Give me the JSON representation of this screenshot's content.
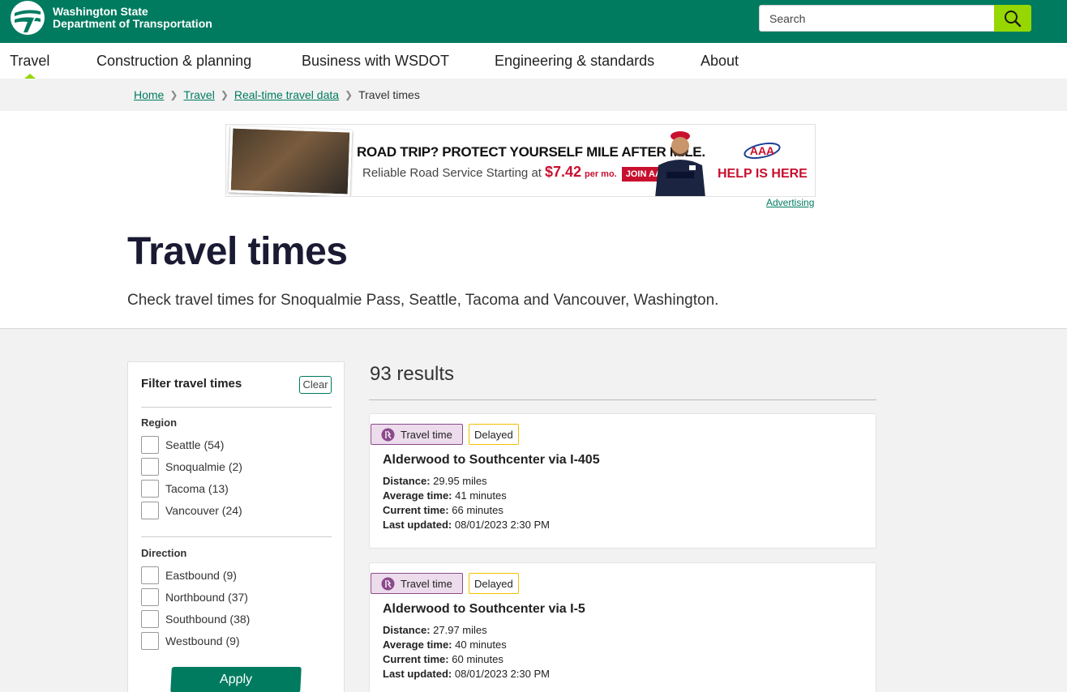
{
  "header": {
    "logo_line1": "Washington State",
    "logo_line2": "Department of Transportation",
    "search_placeholder": "Search",
    "brand_color": "#007b5f",
    "accent_color": "#97d700"
  },
  "nav": {
    "items": [
      {
        "label": "Travel"
      },
      {
        "label": "Construction & planning"
      },
      {
        "label": "Business with WSDOT"
      },
      {
        "label": "Engineering & standards"
      },
      {
        "label": "About"
      }
    ],
    "active": "Travel"
  },
  "breadcrumb": {
    "links": [
      "Home",
      "Travel",
      "Real-time travel data"
    ],
    "current": "Travel times"
  },
  "ad": {
    "headline": "ROAD TRIP? PROTECT YOURSELF MILE AFTER MILE.",
    "sub": "Reliable Road Service Starting at",
    "price": "$7.42",
    "per_month": "per mo.",
    "join": "JOIN AAA",
    "brand": "AAA",
    "help": "HELP IS HERE",
    "label": "Advertising"
  },
  "page": {
    "title": "Travel times",
    "description": "Check travel times for Snoqualmie Pass, Seattle, Tacoma and Vancouver, Washington."
  },
  "filter": {
    "title": "Filter travel times",
    "clear": "Clear",
    "region_title": "Region",
    "regions": [
      "Seattle (54)",
      "Snoqualmie (2)",
      "Tacoma (13)",
      "Vancouver (24)"
    ],
    "direction_title": "Direction",
    "directions": [
      "Eastbound (9)",
      "Northbound (37)",
      "Southbound (38)",
      "Westbound (9)"
    ],
    "apply": "Apply"
  },
  "results": {
    "count": "93 results",
    "items": [
      {
        "tag": "Travel time",
        "status": "Delayed",
        "title": "Alderwood to Southcenter via I-405",
        "distance_label": "Distance:",
        "distance": "29.95 miles",
        "avg_label": "Average time:",
        "avg": "41 minutes",
        "current_label": "Current time:",
        "current": "66 minutes",
        "updated_label": "Last updated:",
        "updated": "08/01/2023 2:30 PM"
      },
      {
        "tag": "Travel time",
        "status": "Delayed",
        "title": "Alderwood to Southcenter via I-5",
        "distance_label": "Distance:",
        "distance": "27.97 miles",
        "avg_label": "Average time:",
        "avg": "40 minutes",
        "current_label": "Current time:",
        "current": "60 minutes",
        "updated_label": "Last updated:",
        "updated": "08/01/2023 2:30 PM"
      }
    ]
  }
}
